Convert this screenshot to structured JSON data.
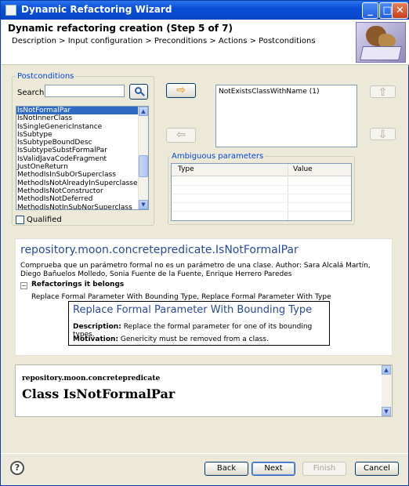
{
  "window": {
    "title": "Dynamic Refactoring Wizard",
    "min_glyph": "_",
    "max_glyph": "□",
    "close_glyph": "✕"
  },
  "header": {
    "title": "Dynamic refactoring creation (Step 5 of 7)",
    "breadcrumb": "Description > Input configuration > Preconditions > Actions > Postconditions"
  },
  "postconditions": {
    "group_label": "Postconditions",
    "search_label": "Search:",
    "search_value": "",
    "items": [
      "IsNotFormalPar",
      "IsNotInnerClass",
      "IsSingleGenericInstance",
      "IsSubtype",
      "IsSubtypeBoundDesc",
      "IsSubtypeSubstFormalPar",
      "IsValidJavaCodeFragment",
      "JustOneReturn",
      "MethodIsInSubOrSuperclass",
      "MethodIsNotAlreadyInSuperclasses",
      "MethodIsNotConstructor",
      "MethodIsNotDeferred",
      "MethodIsNotInSubNorSuperclass"
    ],
    "selected_index": 0,
    "qualified_label": "Qualified",
    "qualified_checked": false
  },
  "selected_postconditions": {
    "items": [
      "NotExistsClassWithName (1)"
    ]
  },
  "ambiguous": {
    "group_label": "Ambiguous parameters",
    "columns": [
      "Type",
      "Value"
    ],
    "rows": []
  },
  "info": {
    "title": "repository.moon.concretepredicate.IsNotFormalPar",
    "description": "Comprueba que un parámetro formal no es un parámetro de una clase. Author: Sara Alcalá Martín, Diego Bañuelos Molledo, Sonia Fuente de la Fuente, Enrique Herrero Paredes",
    "tree_label": "Refactorings it belongs",
    "tree_toggle": "−",
    "tree_child": "Replace Formal Parameter With Bounding Type, Replace Formal Parameter With Type"
  },
  "tooltip": {
    "title": "Replace Formal Parameter With Bounding Type",
    "description_label": "Description:",
    "description": "Replace the formal parameter for one of its bounding types.",
    "motivation_label": "Motivation:",
    "motivation": "Genericity must be removed from a class."
  },
  "doc": {
    "package": "repository.moon.concretepredicate",
    "class_title": "Class IsNotFormalPar"
  },
  "buttons": {
    "back": "Back",
    "next": "Next",
    "finish": "Finish",
    "cancel": "Cancel",
    "help": "?",
    "add_arrow": "⇨",
    "remove_arrow": "⇦",
    "up_arrow": "⇧",
    "down_arrow": "⇩"
  }
}
